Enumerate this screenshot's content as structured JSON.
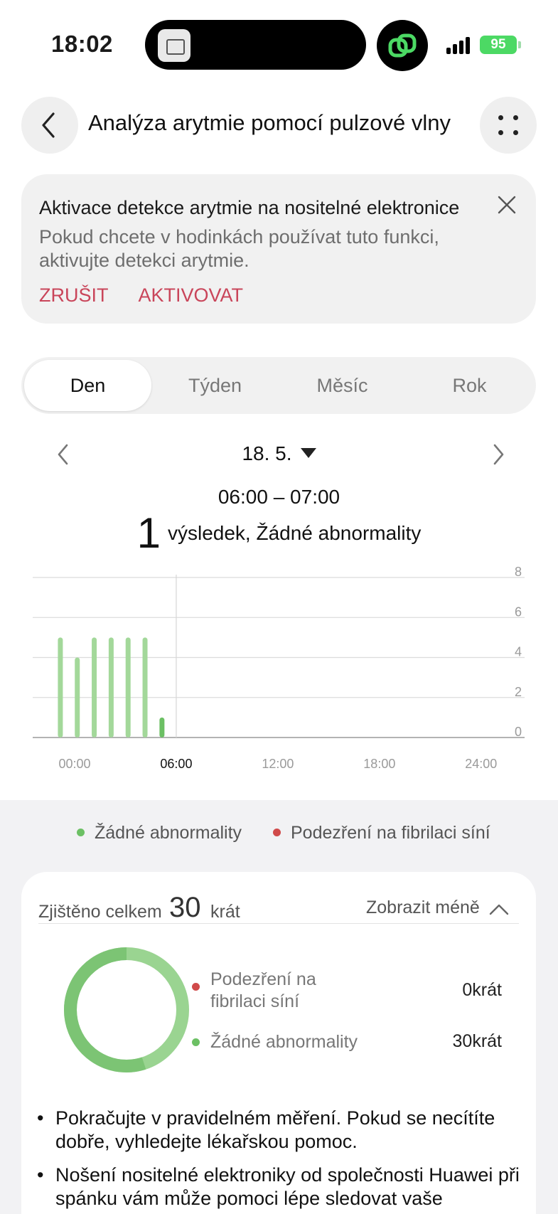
{
  "status_bar": {
    "time": "18:02",
    "battery": "95"
  },
  "header": {
    "title": "Analýza arytmie pomocí pulzové vlny"
  },
  "banner": {
    "title": "Aktivace detekce arytmie na nositelné elektronice",
    "text": "Pokud chcete v hodinkách používat tuto funkci, aktivujte detekci arytmie.",
    "cancel_label": "ZRUŠIT",
    "activate_label": "AKTIVOVAT"
  },
  "tabs": [
    {
      "label": "Den",
      "active": true
    },
    {
      "label": "Týden",
      "active": false
    },
    {
      "label": "Měsíc",
      "active": false
    },
    {
      "label": "Rok",
      "active": false
    }
  ],
  "date_nav": {
    "date": "18. 5."
  },
  "selection": {
    "range": "06:00 – 07:00",
    "count": "1",
    "text": "výsledek, Žádné abnormality"
  },
  "chart_data": {
    "type": "bar",
    "x_unit": "hour",
    "xlim": [
      0,
      24
    ],
    "ylim": [
      0,
      8
    ],
    "y_ticks": [
      "8",
      "6",
      "4",
      "2",
      "0"
    ],
    "x_ticks": [
      "00:00",
      "06:00",
      "12:00",
      "18:00",
      "24:00"
    ],
    "selected_hour": 6,
    "series": [
      {
        "name": "Žádné abnormality",
        "color": "#a3d89a",
        "selected_color": "#6cc064",
        "points": [
          {
            "hour": 0,
            "value": 5
          },
          {
            "hour": 1,
            "value": 4
          },
          {
            "hour": 2,
            "value": 5
          },
          {
            "hour": 3,
            "value": 5
          },
          {
            "hour": 4,
            "value": 5
          },
          {
            "hour": 5,
            "value": 5
          },
          {
            "hour": 6,
            "value": 1
          }
        ]
      }
    ]
  },
  "legend": [
    {
      "label": "Žádné abnormality",
      "color": "#6cc064"
    },
    {
      "label": "Podezření na fibrilaci síní",
      "color": "#d04a4a"
    }
  ],
  "card": {
    "total_label": "Zjištěno celkem",
    "total_value": "30",
    "total_unit": "krát",
    "toggle_label": "Zobrazit méně",
    "rows": [
      {
        "label": "Podezření na fibrilaci síní",
        "value": "0krát",
        "color": "#d04a4a",
        "count": 0
      },
      {
        "label": "Žádné abnormality",
        "value": "30krát",
        "color": "#6cc064",
        "count": 30
      }
    ]
  },
  "tips": [
    "Pokračujte v pravidelném měření. Pokud se necítíte dobře, vyhledejte lékařskou pomoc.",
    "Nošení nositelné elektroniky od společnosti Huawei při spánku vám může pomoci lépe sledovat vaše"
  ]
}
